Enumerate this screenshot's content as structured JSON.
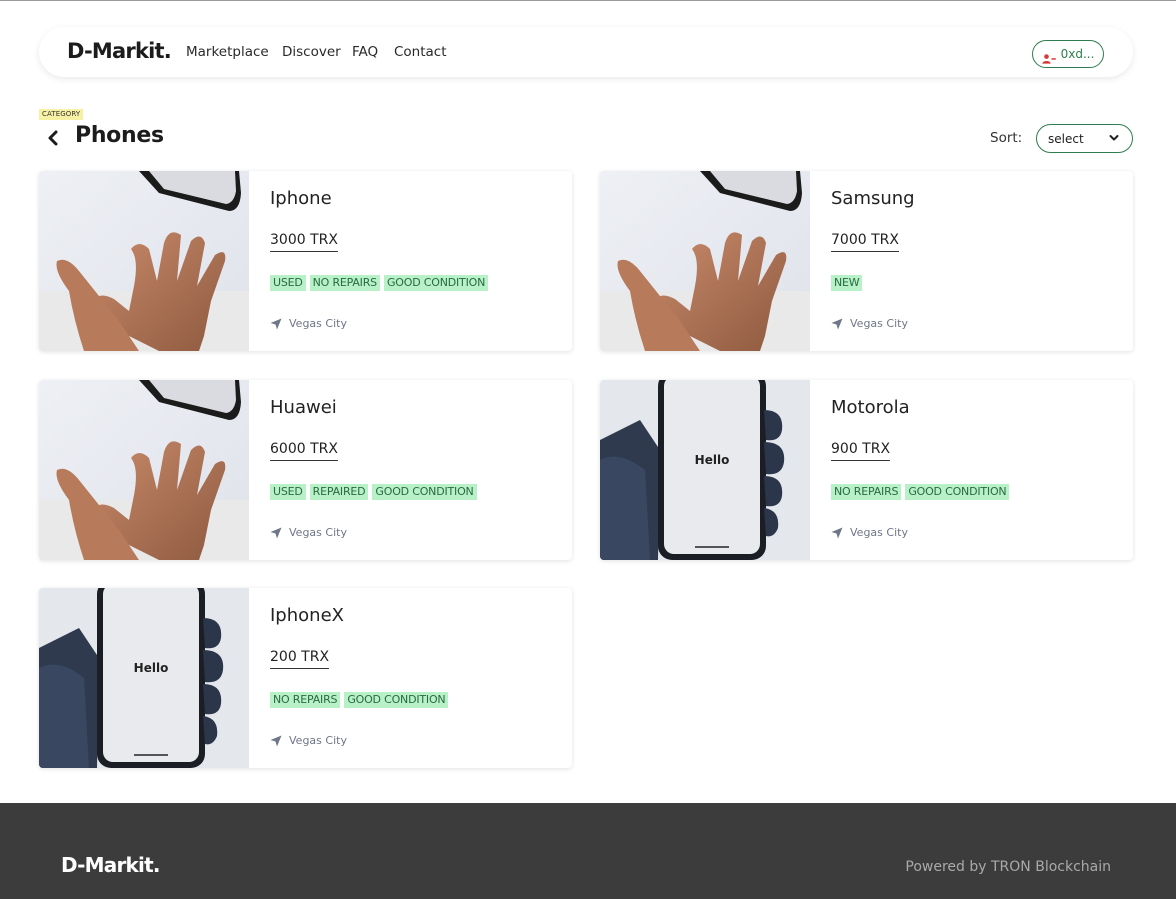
{
  "nav": {
    "brand": "D-Markit.",
    "links": [
      "Marketplace",
      "Discover",
      "FAQ",
      "Contact"
    ],
    "account_label": "0xd...",
    "account_icon": "user-minus-icon"
  },
  "header": {
    "category_tag": "CATEGORY",
    "title": "Phones",
    "sort_label": "Sort:",
    "sort_value": "select"
  },
  "products": [
    {
      "title": "Iphone",
      "price": "3000 TRX",
      "tags": [
        "USED",
        "NO REPAIRS",
        "GOOD CONDITION"
      ],
      "location": "Vegas City",
      "image": "open-hand-photo"
    },
    {
      "title": "Samsung",
      "price": "7000 TRX",
      "tags": [
        "NEW"
      ],
      "location": "Vegas City",
      "image": "open-hand-photo"
    },
    {
      "title": "Huawei",
      "price": "6000 TRX",
      "tags": [
        "USED",
        "REPAIRED",
        "GOOD CONDITION"
      ],
      "location": "Vegas City",
      "image": "open-hand-photo"
    },
    {
      "title": "Motorola",
      "price": "900 TRX",
      "tags": [
        "NO REPAIRS",
        "GOOD CONDITION"
      ],
      "location": "Vegas City",
      "image": "phone-in-hand-photo",
      "image_text": "Hello"
    },
    {
      "title": "IphoneX",
      "price": "200 TRX",
      "tags": [
        "NO REPAIRS",
        "GOOD CONDITION"
      ],
      "location": "Vegas City",
      "image": "phone-in-hand-photo",
      "image_text": "Hello"
    }
  ],
  "footer": {
    "brand": "D-Markit.",
    "credit": "Powered by TRON Blockchain"
  },
  "colors": {
    "accent_green": "#2e7d4f",
    "tag_bg": "#b8f0c8",
    "tag_text": "#276b41",
    "category_tag_bg": "#f7f1a4",
    "footer_bg": "#3c3c3c"
  }
}
